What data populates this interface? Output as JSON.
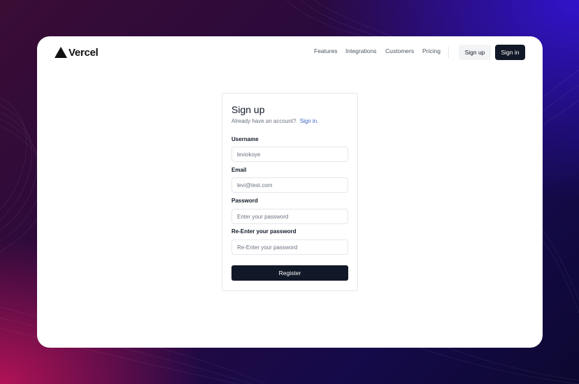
{
  "brand": {
    "name": "Vercel"
  },
  "nav": {
    "links": [
      "Features",
      "Integrations",
      "Customers",
      "Pricing"
    ],
    "signup_label": "Sign up",
    "signin_label": "Sign in"
  },
  "form": {
    "title": "Sign up",
    "subtitle": "Already have an account?",
    "subtitle_link": "Sign in.",
    "fields": [
      {
        "label": "Username",
        "placeholder": "leviokoye"
      },
      {
        "label": "Email",
        "placeholder": "levi@test.com"
      },
      {
        "label": "Password",
        "placeholder": "Enter your password"
      },
      {
        "label": "Re-Enter your password",
        "placeholder": "Re-Enter your password"
      }
    ],
    "submit_label": "Register"
  },
  "colors": {
    "primary_dark": "#111827",
    "link": "#3b63c4",
    "background_magenta": "#c8145a",
    "background_blue": "#3214d2"
  }
}
